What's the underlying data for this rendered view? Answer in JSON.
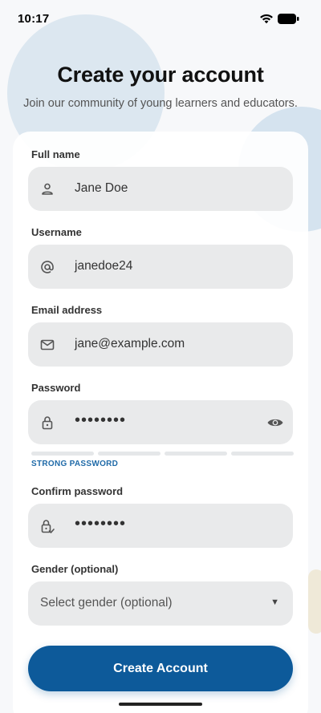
{
  "status_bar": {
    "time": "10:17"
  },
  "header": {
    "title": "Create your account",
    "subtitle": "Join our community of young learners and educators."
  },
  "form": {
    "full_name": {
      "label": "Full name",
      "value": "Jane Doe",
      "icon": "person-icon"
    },
    "username": {
      "label": "Username",
      "value": "janedoe24",
      "icon": "at-sign-icon"
    },
    "email": {
      "label": "Email address",
      "value": "jane@example.com",
      "icon": "mail-icon"
    },
    "password": {
      "label": "Password",
      "value": "••••••••",
      "icon": "lock-icon",
      "toggle_icon": "eye-icon"
    },
    "password_strength": {
      "label": "STRONG PASSWORD",
      "segments": 4,
      "color": "#1f6aa8"
    },
    "confirm_password": {
      "label": "Confirm password",
      "value": "••••••••",
      "icon": "lock-check-icon"
    },
    "gender": {
      "label": "Gender (optional)",
      "value": "Select gender (optional)"
    }
  },
  "submit": {
    "label": "Create Account",
    "color": "#0d5a9a"
  }
}
